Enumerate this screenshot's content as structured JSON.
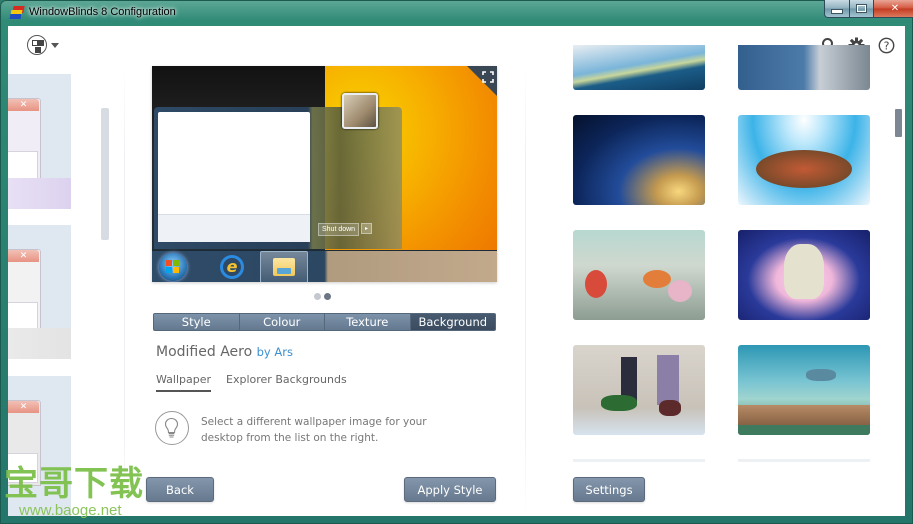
{
  "window": {
    "title": "WindowBlinds 8 Configuration",
    "controls": {
      "minimize": "minimize",
      "maximize": "maximize",
      "close": "✕"
    }
  },
  "toolbar": {
    "view_switch_icon": "grid-view-icon",
    "icons": [
      "search-icon",
      "gear-icon",
      "help-icon"
    ]
  },
  "left_panel": {
    "themes": [
      {
        "name": "theme-preview-1",
        "close_glyph": "✕",
        "tint": "#e6e0f3"
      },
      {
        "name": "theme-preview-2",
        "close_glyph": "✕",
        "tint": "#ececec"
      },
      {
        "name": "theme-preview-3",
        "close_glyph": "✕",
        "tint": "#e8e8e8"
      }
    ]
  },
  "preview": {
    "shutdown_label": "Shut down",
    "shutdown_arrow": "▸",
    "pages": 2,
    "active_page": 2
  },
  "tabs": [
    {
      "label": "Style",
      "active": false
    },
    {
      "label": "Colour",
      "active": false
    },
    {
      "label": "Texture",
      "active": false
    },
    {
      "label": "Background",
      "active": true
    }
  ],
  "theme": {
    "name": "Modified Aero",
    "author": "by Ars"
  },
  "subtabs": [
    {
      "label": "Wallpaper",
      "active": true
    },
    {
      "label": "Explorer Backgrounds",
      "active": false
    }
  ],
  "tip": {
    "icon": "lightbulb-icon",
    "text": "Select a different wallpaper image for your desktop from the list on the right."
  },
  "buttons": {
    "back": "Back",
    "apply": "Apply Style",
    "settings": "Settings"
  },
  "wallpapers": [
    {
      "name": "wallpaper-blue-streak"
    },
    {
      "name": "wallpaper-honeycomb"
    },
    {
      "name": "wallpaper-bridge-arches"
    },
    {
      "name": "wallpaper-flying-turtle"
    },
    {
      "name": "wallpaper-forest-creatures"
    },
    {
      "name": "wallpaper-cloud-creature"
    },
    {
      "name": "wallpaper-walking-castles"
    },
    {
      "name": "wallpaper-flying-town"
    }
  ],
  "watermark": {
    "text": "宝哥下载",
    "url": "www.baoge.net"
  }
}
